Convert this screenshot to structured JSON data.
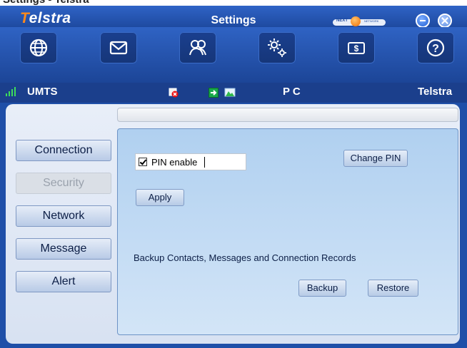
{
  "window": {
    "title_fragment": "Settings - Telstra",
    "brand": {
      "first_letter": "T",
      "rest": "elstra"
    },
    "app_title": "Settings",
    "logo_text": "NEXT",
    "logo_subtext": "NETWORK"
  },
  "toolbar": {
    "items": [
      {
        "name": "internet",
        "icon": "globe-icon"
      },
      {
        "name": "messages",
        "icon": "envelope-icon"
      },
      {
        "name": "contacts",
        "icon": "contacts-icon"
      },
      {
        "name": "settings",
        "icon": "gears-icon"
      },
      {
        "name": "account",
        "icon": "money-icon"
      },
      {
        "name": "help",
        "icon": "help-icon"
      }
    ]
  },
  "status": {
    "network_type": "UMTS",
    "mode": "P C",
    "operator": "Telstra"
  },
  "sidebar": {
    "items": [
      {
        "label": "Connection",
        "selected": false
      },
      {
        "label": "Security",
        "selected": true
      },
      {
        "label": "Network",
        "selected": false
      },
      {
        "label": "Message",
        "selected": false
      },
      {
        "label": "Alert",
        "selected": false
      }
    ]
  },
  "security": {
    "pin_enable_label": "PIN enable",
    "pin_enable_checked": true,
    "change_pin_label": "Change PIN",
    "apply_label": "Apply",
    "backup_info": "Backup Contacts, Messages and Connection Records",
    "backup_label": "Backup",
    "restore_label": "Restore"
  },
  "colors": {
    "frame": "#1f4fa8",
    "toolbar": "#2a5bb9",
    "status_bar": "#1b3f8c",
    "brand_accent": "#ff8a1c",
    "panel": "#c4dcf3"
  }
}
